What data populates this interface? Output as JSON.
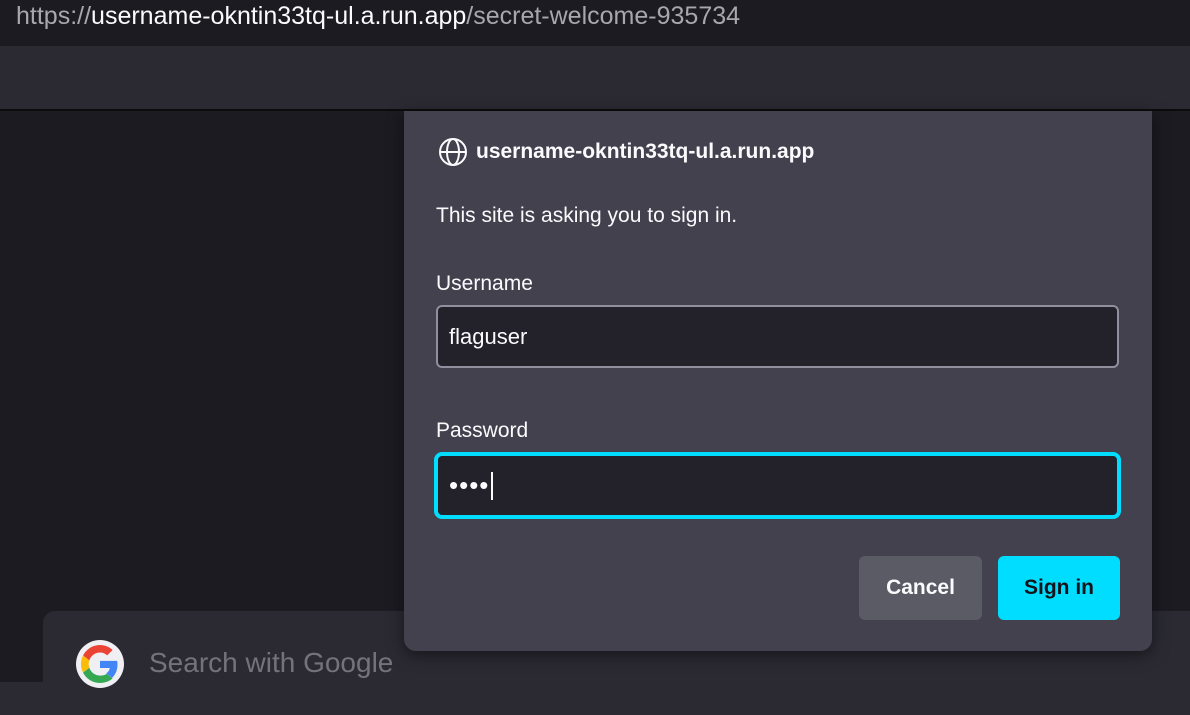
{
  "url_bar": {
    "scheme": "https://",
    "host": "username-okntin33tq-ul.a.run.app",
    "path": "/secret-welcome-935734"
  },
  "new_tab": {
    "search_placeholder": "Search with Google"
  },
  "auth_dialog": {
    "host": "username-okntin33tq-ul.a.run.app",
    "message": "This site is asking you to sign in.",
    "username_label": "Username",
    "username_value": "flaguser",
    "password_label": "Password",
    "password_masked": "••••",
    "cancel_label": "Cancel",
    "signin_label": "Sign in"
  },
  "colors": {
    "accent": "#00ddff",
    "dialog_bg": "#42414d",
    "page_bg": "#1c1b22"
  }
}
